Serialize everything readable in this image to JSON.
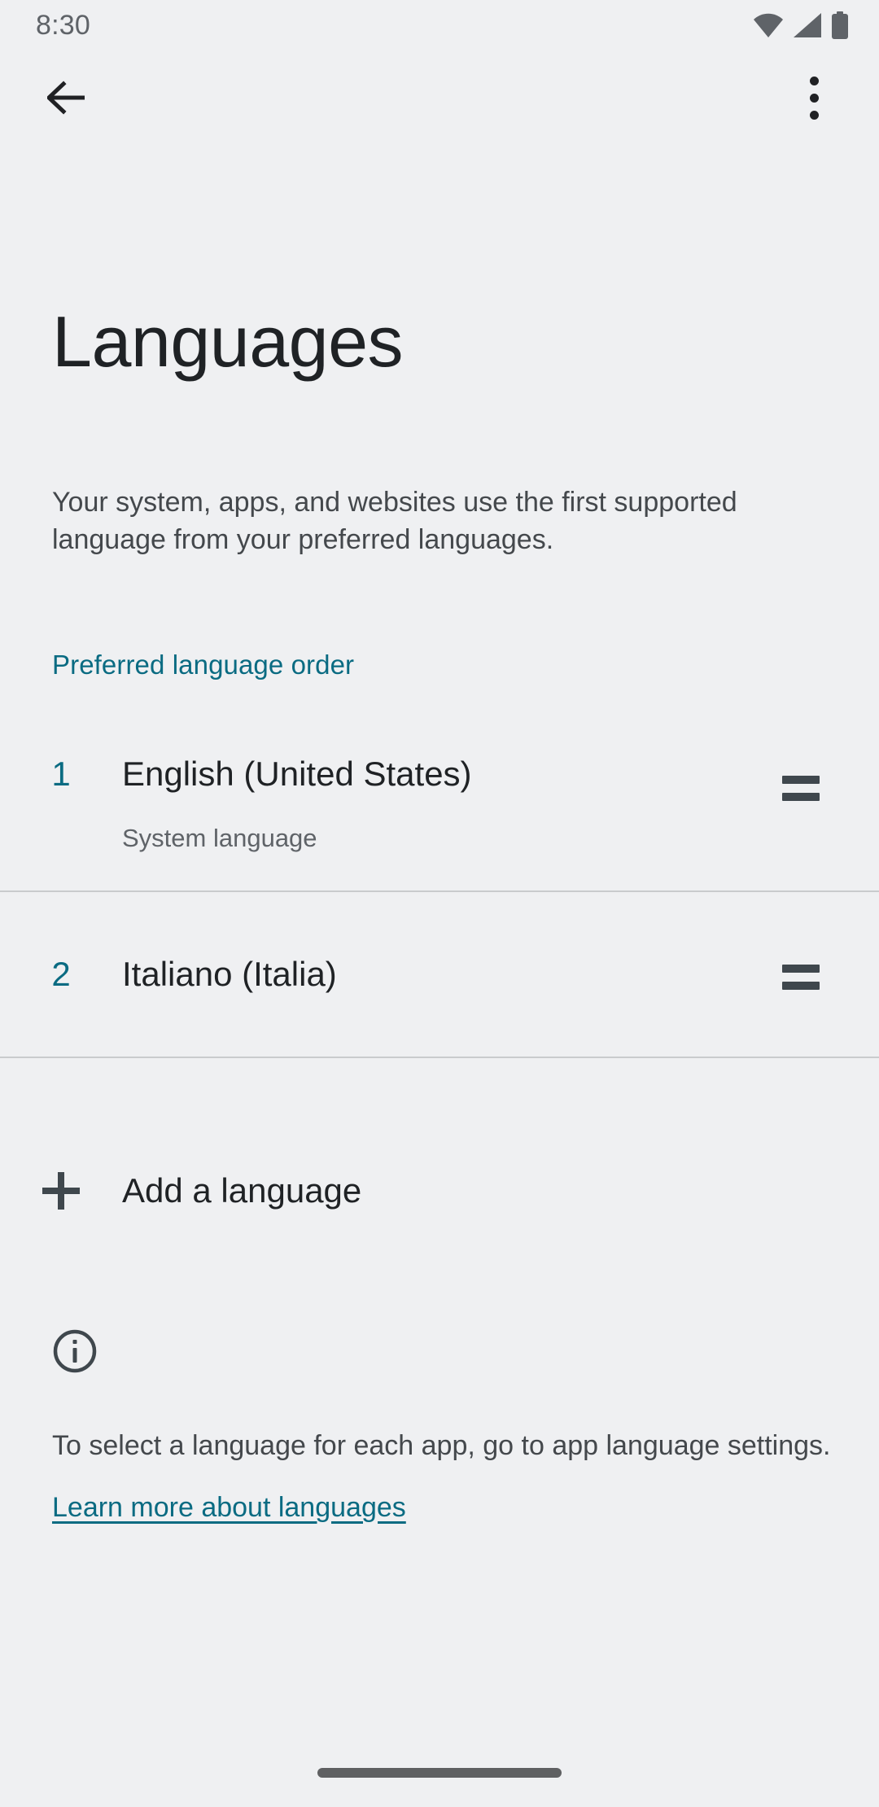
{
  "colors": {
    "background": "#eff0f2",
    "accent": "#0a6b82",
    "primary_text": "#1f2225",
    "secondary_text": "#44484c",
    "tertiary_text": "#5f6368",
    "divider": "#c9cbcd",
    "icon": "#3f474d"
  },
  "status_bar": {
    "time": "8:30",
    "icons": [
      "wifi-icon",
      "cellular-signal-icon",
      "battery-icon"
    ]
  },
  "app_bar": {
    "back_icon": "back-arrow-icon",
    "overflow_icon": "more-options-icon"
  },
  "header": {
    "title": "Languages",
    "description": "Your system, apps, and websites use the first supported language from your preferred languages."
  },
  "section": {
    "label": "Preferred language order"
  },
  "languages": [
    {
      "index": "1",
      "name": "English (United States)",
      "subtitle": "System language",
      "handle_icon": "drag-handle-icon"
    },
    {
      "index": "2",
      "name": "Italiano (Italia)",
      "subtitle": "",
      "handle_icon": "drag-handle-icon"
    }
  ],
  "add_language": {
    "label": "Add a language",
    "icon": "plus-icon"
  },
  "footer": {
    "icon": "info-icon",
    "text": "To select a language for each app, go to app language settings.",
    "link_label": "Learn more about languages"
  },
  "navigation": {
    "gesture_bar": "home-gesture-bar"
  }
}
